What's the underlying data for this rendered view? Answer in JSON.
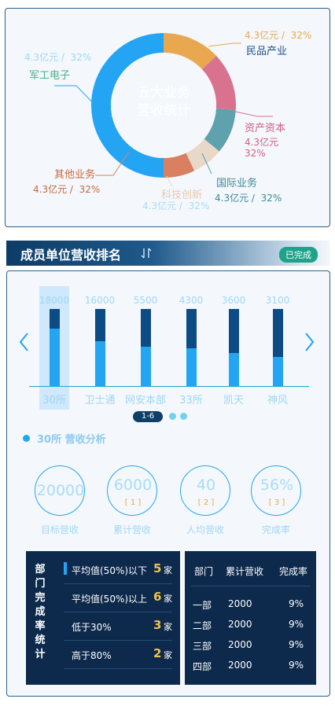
{
  "donut": {
    "center_title_line1": "五大业务",
    "center_title_line2": "营收统计",
    "segments": [
      {
        "name": "民品产业",
        "amount": "4.3亿元",
        "percent": "32%",
        "share": 0.13,
        "color": "#e9a84f",
        "name_color": "#1d4d86",
        "value_color": "#e9a84f"
      },
      {
        "name": "资产资本",
        "amount": "4.3亿元",
        "percent": "32%",
        "share": 0.13,
        "color": "#d9728e",
        "name_color": "#d25f84",
        "value_color": "#d25f84"
      },
      {
        "name": "国际业务",
        "amount": "4.3亿元",
        "percent": "32%",
        "share": 0.1,
        "color": "#5fa1ad",
        "name_color": "#3c8a9a",
        "value_color": "#3c8a9a"
      },
      {
        "name": "科技创新",
        "amount": "4.3亿元",
        "percent": "32%",
        "share": 0.07,
        "color": "#e7d8c7",
        "name_color": "#e8c8b0",
        "value_color": "#a9dcf6"
      },
      {
        "name": "其他业务",
        "amount": "4.3亿元",
        "percent": "32%",
        "share": 0.07,
        "color": "#d88060",
        "name_color": "#c9673e",
        "value_color": "#c9673e"
      },
      {
        "name": "军工电子",
        "amount": "4.3亿元",
        "percent": "32%",
        "share": 0.5,
        "color": "#23a5f3",
        "name_color": "#4cae8a",
        "value_color": "#9fd6f6"
      }
    ]
  },
  "ranking": {
    "title": "成员单位营收排名",
    "status": "已完成",
    "chart_data": {
      "type": "bar",
      "categories": [
        "30所",
        "卫士通",
        "网安本部",
        "33所",
        "凯天",
        "神风"
      ],
      "values": [
        18000,
        16000,
        5500,
        4300,
        3600,
        3100
      ],
      "lower_fraction": [
        0.74,
        0.58,
        0.51,
        0.49,
        0.43,
        0.38
      ],
      "highlighted": 0
    },
    "pager": {
      "current": "1-6"
    }
  },
  "analysis": {
    "title": "30所  营收分析",
    "kpis": [
      {
        "value": "20000",
        "sub": "",
        "label": "目标营收"
      },
      {
        "value": "6000",
        "sub": "[ 1 ]",
        "label": "累计营收"
      },
      {
        "value": "40",
        "sub": "[ 2 ]",
        "label": "人均营收"
      },
      {
        "value": "56%",
        "sub": "[ 3 ]",
        "label": "完成率"
      }
    ]
  },
  "stats": {
    "title": "部门完成率统计",
    "rows": [
      {
        "label": "平均值(50%)以下",
        "count": "5",
        "unit": "家"
      },
      {
        "label": "平均值(50%)以上",
        "count": "6",
        "unit": "家"
      },
      {
        "label": "低于30%",
        "count": "3",
        "unit": "家"
      },
      {
        "label": "高于80%",
        "count": "2",
        "unit": "家"
      }
    ]
  },
  "dept_table": {
    "headers": [
      "部门",
      "累计营收",
      "完成率"
    ],
    "rows": [
      [
        "一部",
        "2000",
        "9%"
      ],
      [
        "二部",
        "2000",
        "9%"
      ],
      [
        "三部",
        "2000",
        "9%"
      ],
      [
        "四部",
        "2000",
        "9%"
      ]
    ]
  }
}
